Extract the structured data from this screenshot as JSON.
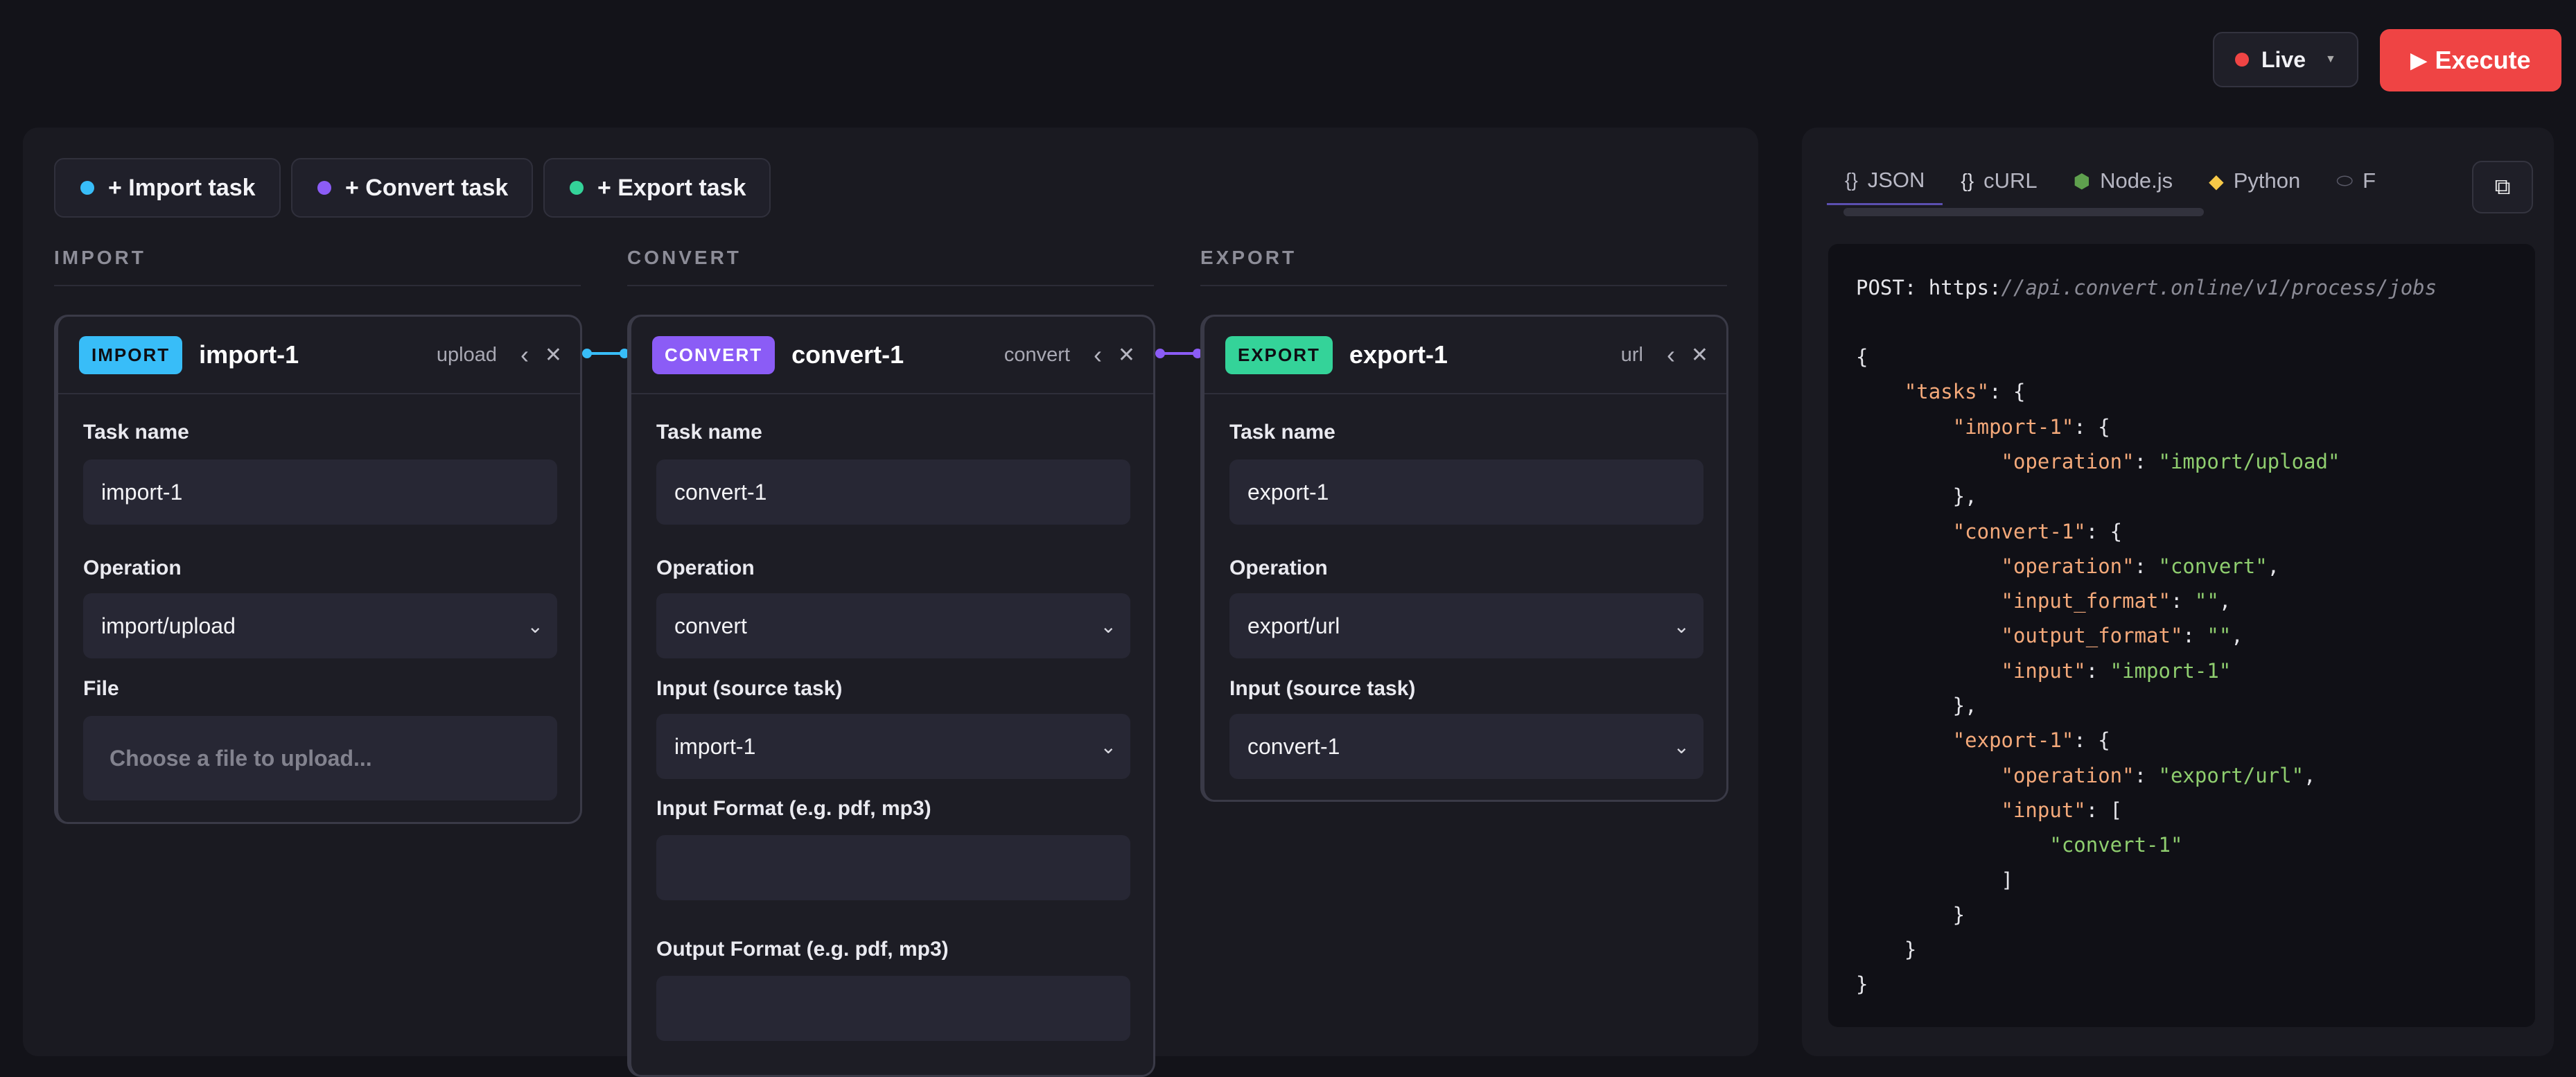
{
  "header": {
    "live_label": "Live",
    "execute_label": "Execute"
  },
  "toolbar": {
    "add_import": "+ Import task",
    "add_convert": "+ Convert task",
    "add_export": "+ Export task"
  },
  "columns": {
    "import": "IMPORT",
    "convert": "CONVERT",
    "export": "EXPORT"
  },
  "cards": {
    "import": {
      "badge": "IMPORT",
      "title": "import-1",
      "op": "upload",
      "task_name_label": "Task name",
      "task_name": "import-1",
      "operation_label": "Operation",
      "operation": "import/upload",
      "file_label": "File",
      "file_placeholder": "Choose a file to upload..."
    },
    "convert": {
      "badge": "CONVERT",
      "title": "convert-1",
      "op": "convert",
      "task_name_label": "Task name",
      "task_name": "convert-1",
      "operation_label": "Operation",
      "operation": "convert",
      "input_label": "Input (source task)",
      "input": "import-1",
      "input_format_label": "Input Format (e.g. pdf, mp3)",
      "input_format": "",
      "output_format_label": "Output Format (e.g. pdf, mp3)",
      "output_format": ""
    },
    "export": {
      "badge": "EXPORT",
      "title": "export-1",
      "op": "url",
      "task_name_label": "Task name",
      "task_name": "export-1",
      "operation_label": "Operation",
      "operation": "export/url",
      "input_label": "Input (source task)",
      "input": "convert-1"
    }
  },
  "code_panel": {
    "tabs": [
      {
        "label": "JSON",
        "icon": "{}"
      },
      {
        "label": "cURL",
        "icon": "{}"
      },
      {
        "label": "Node.js",
        "icon": "node-icon"
      },
      {
        "label": "Python",
        "icon": "python-icon"
      },
      {
        "label": "F",
        "icon": "php-icon"
      }
    ],
    "active_tab": "JSON",
    "post_label": "POST:",
    "url_scheme": "https:",
    "url_path": "//api.convert.online/v1/process/jobs",
    "code_lines": [
      [
        "{",
        ""
      ],
      [
        "    \"tasks\": {",
        ""
      ],
      [
        "        \"import-1\": {",
        ""
      ],
      [
        "            \"operation\": \"import/upload\"",
        ""
      ],
      [
        "        },",
        ""
      ],
      [
        "        \"convert-1\": {",
        ""
      ],
      [
        "            \"operation\": \"convert\",",
        ""
      ],
      [
        "            \"input_format\": \"\",",
        ""
      ],
      [
        "            \"output_format\": \"\",",
        ""
      ],
      [
        "            \"input\": \"import-1\"",
        ""
      ],
      [
        "        },",
        ""
      ],
      [
        "        \"export-1\": {",
        ""
      ],
      [
        "            \"operation\": \"export/url\",",
        ""
      ],
      [
        "            \"input\": [",
        ""
      ],
      [
        "                \"convert-1\"",
        ""
      ],
      [
        "            ]",
        ""
      ],
      [
        "        }",
        ""
      ],
      [
        "    }",
        ""
      ],
      [
        "}",
        ""
      ]
    ]
  },
  "colors": {
    "import": "#38bdf8",
    "convert": "#8b5cf6",
    "export": "#34d399",
    "execute": "#ef4444"
  }
}
